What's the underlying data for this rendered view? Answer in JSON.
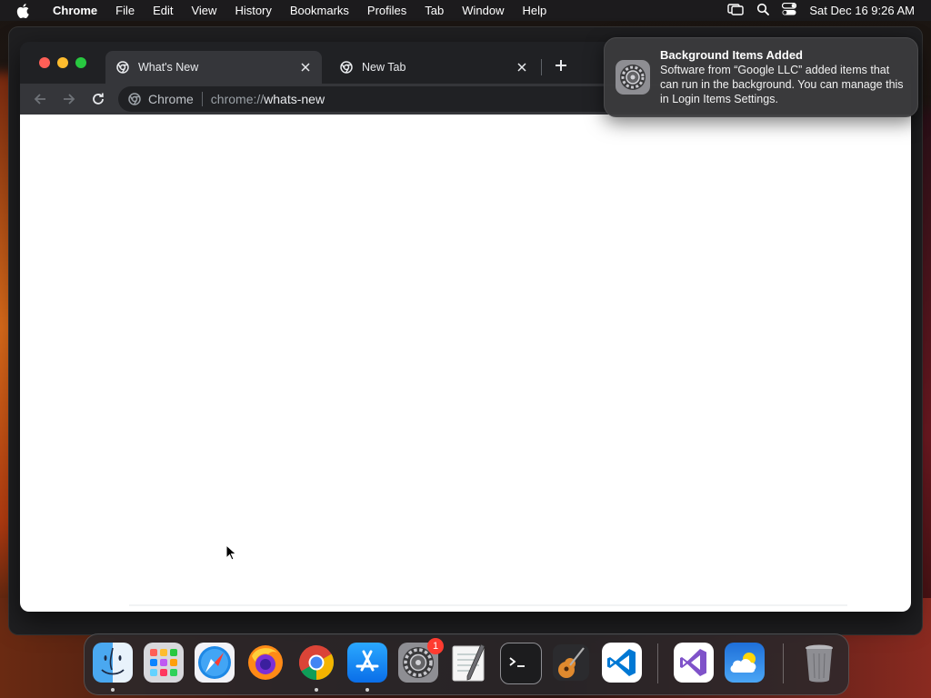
{
  "menubar": {
    "app_name": "Chrome",
    "items": [
      "File",
      "Edit",
      "View",
      "History",
      "Bookmarks",
      "Profiles",
      "Tab",
      "Window",
      "Help"
    ],
    "clock": "Sat Dec 16  9:26 AM",
    "status_icons": [
      "screen-mirroring-icon",
      "spotlight-search-icon",
      "control-center-icon"
    ]
  },
  "browser": {
    "tabs": [
      {
        "title": "What's New",
        "active": true
      },
      {
        "title": "New Tab",
        "active": false
      }
    ],
    "omnibox": {
      "chip": "Chrome",
      "scheme": "chrome://",
      "path": "whats-new"
    }
  },
  "notification": {
    "title": "Background Items Added",
    "body": "Software from “Google LLC” added items that can run in the background. You can manage this in Login Items Settings."
  },
  "dock": {
    "apps": [
      {
        "name": "Finder",
        "running": true
      },
      {
        "name": "Launchpad",
        "running": false
      },
      {
        "name": "Safari",
        "running": false
      },
      {
        "name": "Firefox",
        "running": false
      },
      {
        "name": "Google Chrome",
        "running": true
      },
      {
        "name": "App Store",
        "running": true
      },
      {
        "name": "System Settings",
        "running": false,
        "badge": "1"
      },
      {
        "name": "TextEdit",
        "running": false
      },
      {
        "name": "Terminal",
        "running": false
      },
      {
        "name": "GarageBand",
        "running": false
      },
      {
        "name": "Visual Studio Code",
        "running": false
      },
      {
        "name": "Visual Studio",
        "running": false
      },
      {
        "name": "Weather",
        "running": false
      },
      {
        "name": "Trash",
        "running": false
      }
    ]
  },
  "colors": {
    "menubar_bg": "#1c1b1d",
    "chrome_frame": "#202124",
    "chrome_toolbar": "#35363a",
    "notification_bg": "#3a3a3c",
    "badge_red": "#ff3b30"
  }
}
